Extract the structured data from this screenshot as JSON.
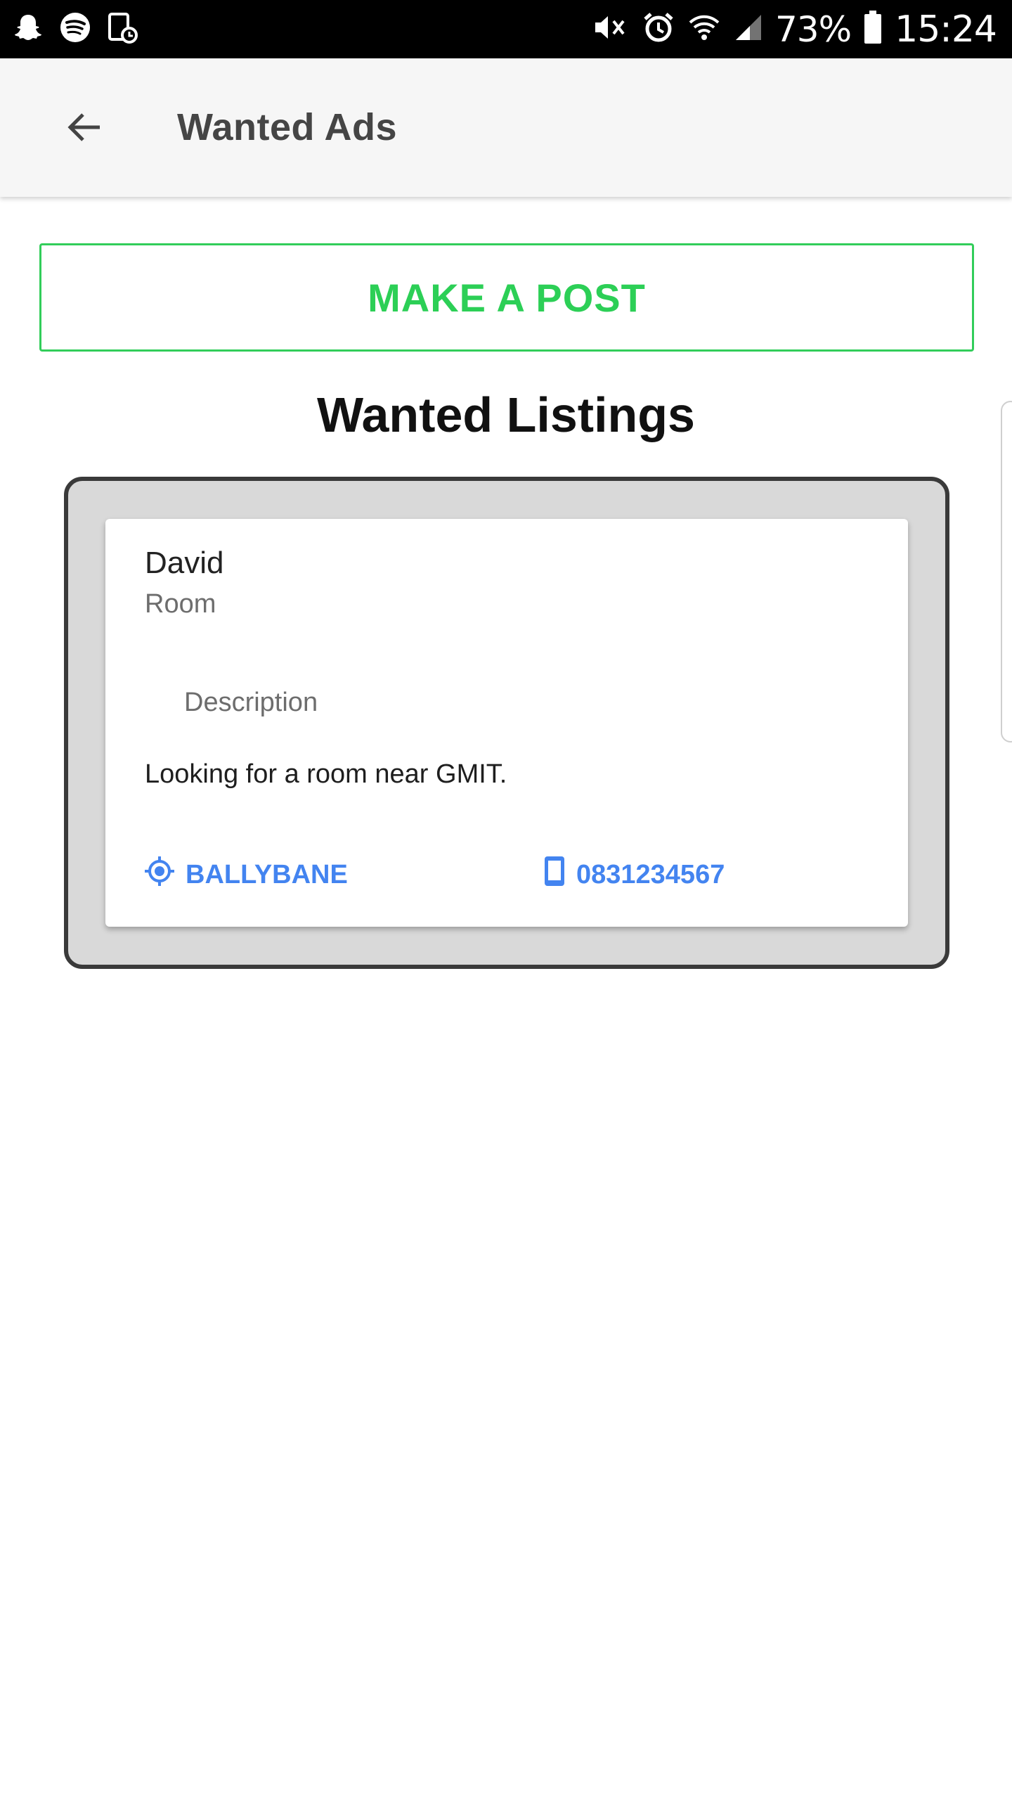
{
  "status_bar": {
    "battery_percent": "73%",
    "time": "15:24",
    "left_icons": [
      "snapchat-icon",
      "spotify-icon",
      "screenshot-icon"
    ],
    "right_icons": [
      "vibrate-mute-icon",
      "alarm-icon",
      "wifi-icon",
      "signal-icon",
      "battery-icon"
    ]
  },
  "app_bar": {
    "title": "Wanted Ads",
    "back_icon": "arrow-left-icon"
  },
  "actions": {
    "make_post_label": "MAKE A POST"
  },
  "section": {
    "title": "Wanted Listings"
  },
  "listing": {
    "name": "David",
    "type": "Room",
    "description_label": "Description",
    "description": "Looking for a room near GMIT.",
    "location": "BALLYBANE",
    "phone": "0831234567",
    "location_icon": "location-target-icon",
    "phone_icon": "smartphone-icon"
  },
  "colors": {
    "accent_green": "#2ccf56",
    "link_blue": "#4384f0",
    "frame_border": "#3a3a3a",
    "frame_bg": "#d9d9d9",
    "app_bar_bg": "#f6f6f6"
  }
}
